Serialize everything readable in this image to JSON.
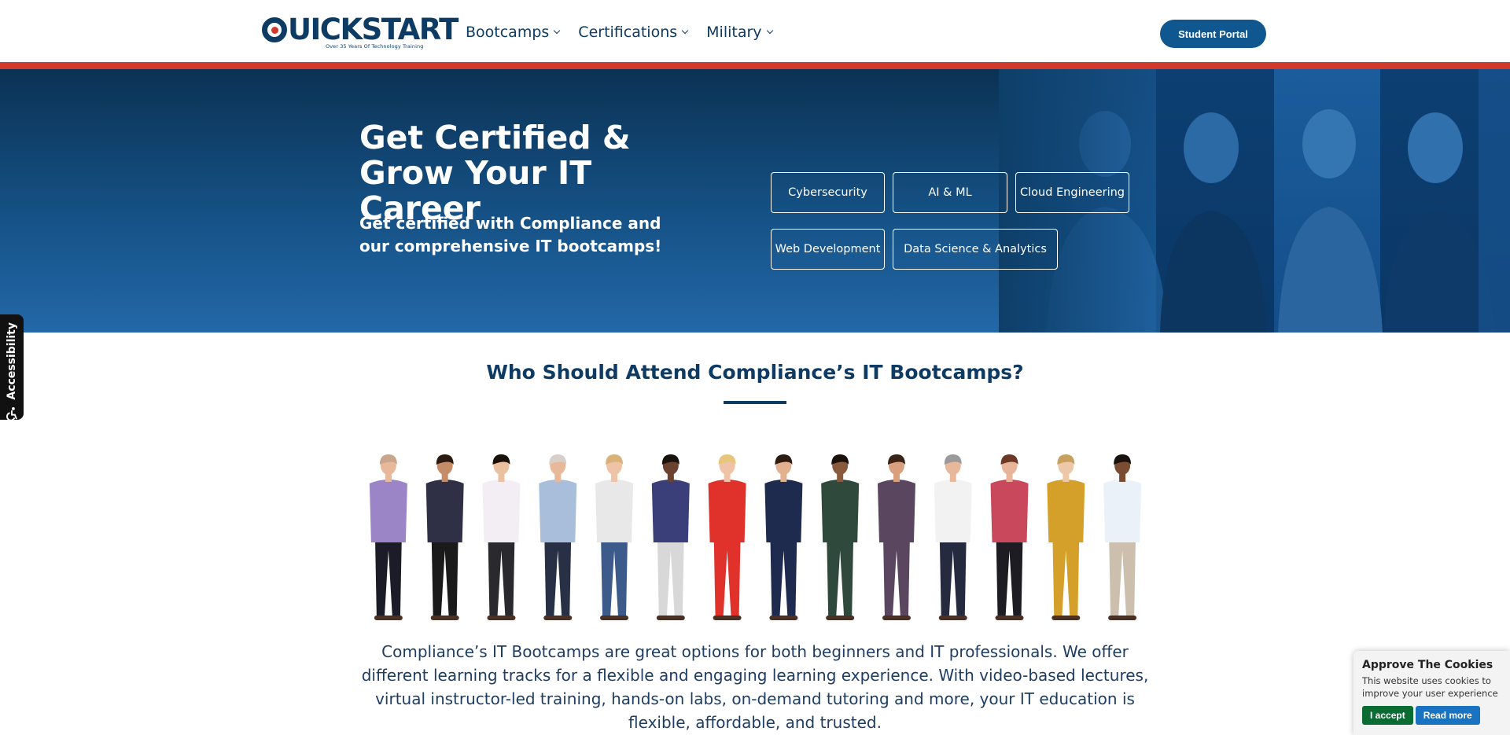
{
  "brand": {
    "logo_word": "QUICKSTART",
    "logo_tagline": "Over 35 Years Of Technology Training",
    "primary": "#0e3b63",
    "accent": "#d13a2a",
    "button": "#11578f"
  },
  "nav": {
    "items": [
      {
        "label": "Bootcamps"
      },
      {
        "label": "Certifications"
      },
      {
        "label": "Military"
      }
    ],
    "portal_label": "Student Portal"
  },
  "hero": {
    "title": "Get Certified & Grow Your IT Career",
    "subtitle": "Get certified with Compliance and our comprehensive IT bootcamps!",
    "chips": [
      {
        "label": "Cybersecurity"
      },
      {
        "label": "AI & ML"
      },
      {
        "label": "Cloud Engineering"
      },
      {
        "label": "Web Development"
      },
      {
        "label": "Data Science & Analytics"
      }
    ]
  },
  "attend": {
    "title": "Who Should Attend Compliance’s IT Bootcamps?",
    "description": "Compliance’s IT Bootcamps are great options for both beginners and IT professionals. We offer different learning tracks for a flexible and engaging learning experience. With video-based lectures, virtual instructor-led training, hands-on labs, on-demand tutoring and more, your IT education is flexible, affordable, and trusted."
  },
  "accessibility": {
    "label": "Accessibility"
  },
  "cookie": {
    "title": "Approve The Cookies",
    "text": "This website uses cookies to improve your user experience",
    "accept_label": "I accept",
    "more_label": "Read more"
  }
}
